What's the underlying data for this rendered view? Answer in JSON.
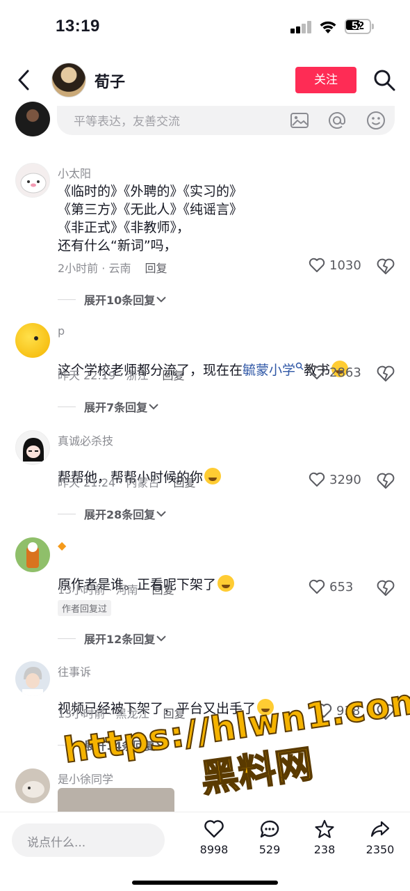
{
  "status_bar": {
    "time": "13:19",
    "battery": "52"
  },
  "header": {
    "author_name": "荀子",
    "follow_label": "关注"
  },
  "comment_input": {
    "placeholder": "平等表达，友善交流"
  },
  "comments": [
    {
      "user": "小太阳",
      "text": "《临时的》《外聘的》《实习的》\n《第三方》《无此人》《纯谣言》\n《非正式》《非教师》，\n还有什么“新词”吗，",
      "meta": "2小时前 · 云南",
      "reply": "回复",
      "likes": "1030",
      "expand": "展开10条回复"
    },
    {
      "user": "p",
      "text_before": "这个学校老师都分流了，现在在",
      "text_link": "毓蒙小学",
      "text_after": "教书",
      "meta": "昨天 22:19 · 浙江",
      "reply": "回复",
      "likes": "2863",
      "expand": "展开7条回复"
    },
    {
      "user": "真诚必杀技",
      "text": "帮帮他，帮帮小时候的你",
      "meta": "昨天 21:24 · 内蒙古",
      "reply": "回复",
      "likes": "3290",
      "expand": "展开28条回复"
    },
    {
      "user": "◆",
      "text": "原作者是谁。正看呢下架了",
      "meta": "13小时前 · 河南",
      "reply": "回复",
      "likes": "653",
      "tag": "作者回复过",
      "expand": "展开12条回复"
    },
    {
      "user": "往事诉",
      "text": "视频已经被下架了，平台又出手了",
      "meta": "13小时前 · 黑龙江",
      "reply": "回复",
      "likes": "938",
      "expand": "展开14条回复"
    },
    {
      "user": "是小徐同学"
    }
  ],
  "watermark": {
    "url": "https://hlwn1.com",
    "name": "黑料网"
  },
  "bottom_bar": {
    "placeholder": "说点什么...",
    "likes": "8998",
    "comments": "529",
    "favorites": "238",
    "shares": "2350"
  },
  "colors": {
    "accent": "#fe2c55",
    "link": "#2f57a6",
    "muted": "#8a8b91"
  }
}
